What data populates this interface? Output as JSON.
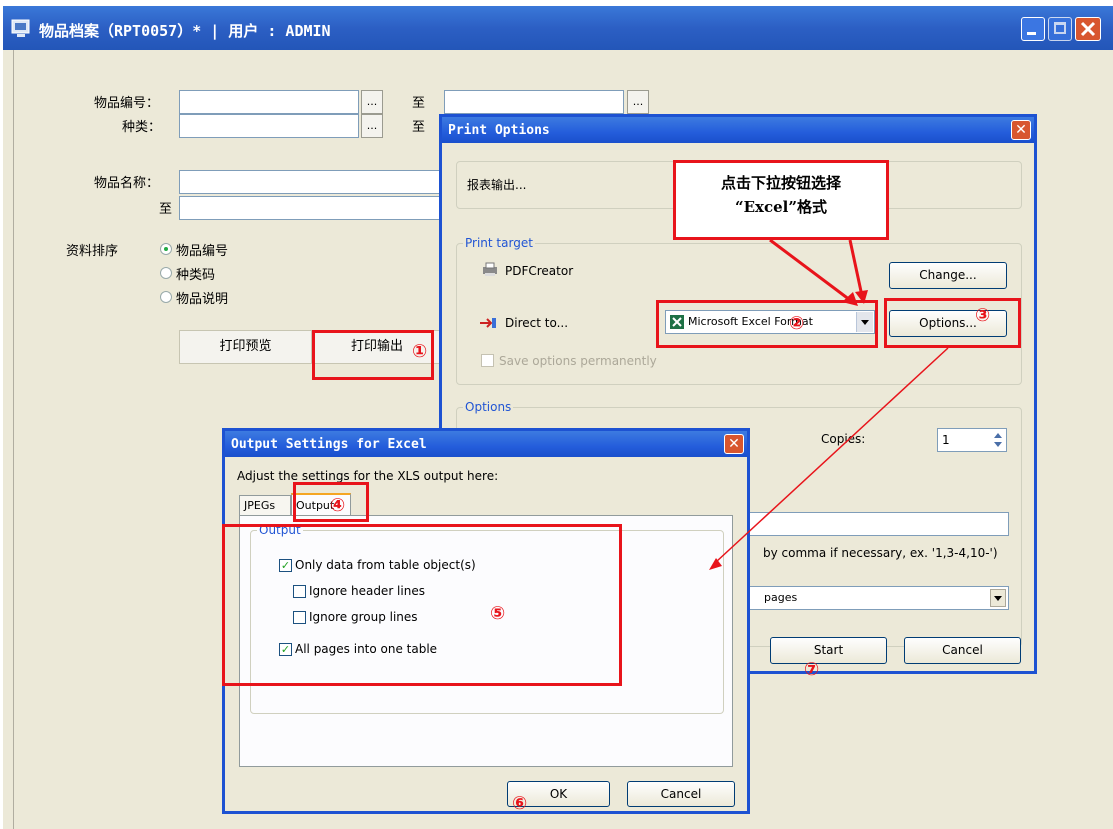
{
  "main": {
    "title": "物品档案（RPT0057）* | 用户 : ADMIN",
    "fields": {
      "item_no_label": "物品编号：",
      "category_label": "种类：",
      "to_label": "至",
      "item_name_label": "物品名称：",
      "to_label2": "至",
      "dots": "..."
    },
    "sort": {
      "label": "资料排序",
      "options": [
        "物品编号",
        "种类码",
        "物品说明"
      ],
      "selected": "物品编号"
    },
    "buttons": {
      "preview": "打印预览",
      "print": "打印输出"
    }
  },
  "print_options": {
    "title": "Print Options",
    "report_output": "报表输出...",
    "print_target_title": "Print target",
    "printer": "PDFCreator",
    "change_label": "Change...",
    "direct_to": "Direct to...",
    "format_selected": "Microsoft Excel Format",
    "options_label": "Options...",
    "save_permanently": "Save options permanently",
    "options_title": "Options",
    "copies_label": "Copies:",
    "copies_value": "1",
    "pages_hint": "by comma if necessary, ex. '1,3-4,10-')",
    "pages_select": "pages",
    "start_label": "Start",
    "cancel_label": "Cancel"
  },
  "output_settings": {
    "title": "Output Settings for Excel",
    "description": "Adjust the settings for the XLS output here:",
    "tabs": [
      "JPEGs",
      "Output"
    ],
    "active_tab": "Output",
    "group_title": "Output",
    "options": [
      {
        "label": "Only data from table object(s)",
        "checked": true
      },
      {
        "label": "Ignore header lines",
        "checked": false
      },
      {
        "label": "Ignore group lines",
        "checked": false
      },
      {
        "label": "All pages into one table",
        "checked": true
      }
    ],
    "ok_label": "OK",
    "cancel_label": "Cancel"
  },
  "annotations": {
    "callout_text": "点击下拉按钮选择\n“Excel”格式",
    "markers": [
      "①",
      "②",
      "③",
      "④",
      "⑤",
      "⑥",
      "⑦"
    ],
    "color": "#e8141b"
  },
  "icons": [
    "window-app-icon",
    "minimize-icon",
    "maximize-icon",
    "close-icon",
    "printer-icon",
    "direct-to-icon",
    "excel-icon",
    "dropdown-arrow-icon",
    "spinner-icon"
  ]
}
